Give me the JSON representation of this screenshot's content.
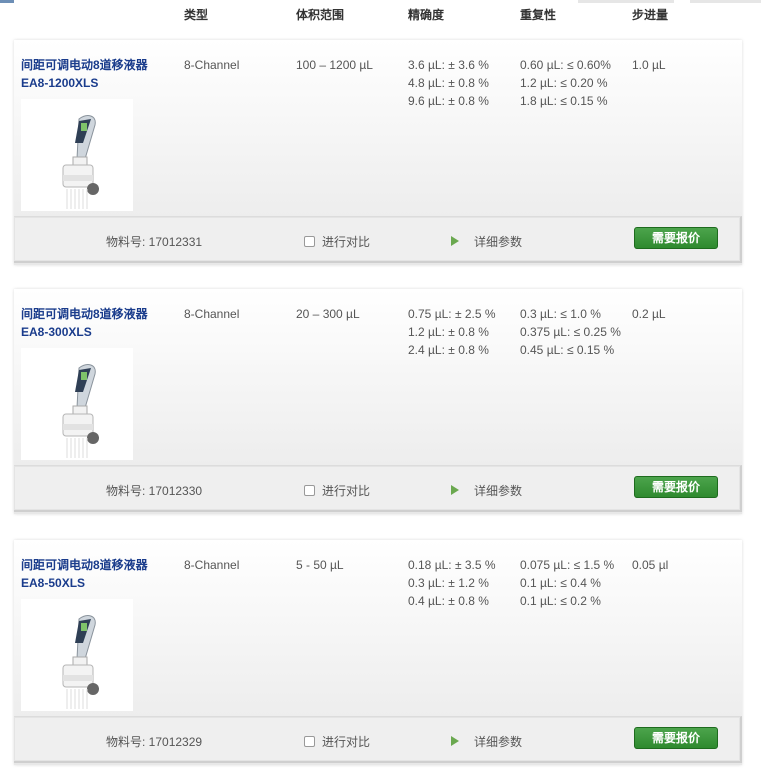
{
  "columns": {
    "type": "类型",
    "volume": "体积范围",
    "accuracy": "精确度",
    "repeatability": "重复性",
    "step": "步进量"
  },
  "products": [
    {
      "title": "间距可调电动8道移液器",
      "model": "EA8-1200XLS",
      "type": "8-Channel",
      "volume": "100 – 1200 µL",
      "accuracy": [
        "3.6 µL: ± 3.6 %",
        "4.8 µL: ± 0.8 %",
        "9.6 µL: ± 0.8 %"
      ],
      "repeatability": [
        "0.60 µL: ≤ 0.60%",
        "1.2 µL: ≤ 0.20 %",
        "1.8 µL: ≤ 0.15 %"
      ],
      "step": "1.0 µL",
      "material_label": "物料号: 17012331",
      "compare_label": "进行对比",
      "details_label": "详细参数",
      "quote_label": "需要报价"
    },
    {
      "title": "间距可调电动8道移液器",
      "model": "EA8-300XLS",
      "type": "8-Channel",
      "volume": "20 – 300 µL",
      "accuracy": [
        "0.75 µL: ± 2.5 %",
        "1.2 µL: ± 0.8 %",
        "2.4 µL: ± 0.8 %"
      ],
      "repeatability": [
        "0.3 µL: ≤ 1.0 %",
        "0.375 µL: ≤ 0.25 %",
        "0.45 µL: ≤ 0.15 %"
      ],
      "step": "0.2 µL",
      "material_label": "物料号: 17012330",
      "compare_label": "进行对比",
      "details_label": "详细参数",
      "quote_label": "需要报价"
    },
    {
      "title": "间距可调电动8道移液器",
      "model": "EA8-50XLS",
      "type": "8-Channel",
      "volume": "5 - 50 µL",
      "accuracy": [
        "0.18 µL: ± 3.5 %",
        "0.3 µL: ± 1.2 %",
        "0.4 µL: ± 0.8 %"
      ],
      "repeatability": [
        "0.075 µL: ≤ 1.5 %",
        "0.1 µL: ≤ 0.4 %",
        "0.1 µL: ≤ 0.2 %"
      ],
      "step": "0.05 µl",
      "material_label": "物料号: 17012329",
      "compare_label": "进行对比",
      "details_label": "详细参数",
      "quote_label": "需要报价"
    }
  ],
  "colors": {
    "title": "#1a3c8c",
    "quote_button": "#3a973a",
    "details_arrow": "#6aa84f"
  },
  "icons": {
    "compare": "checkbox-icon",
    "details": "play-arrow-icon",
    "product": "pipette-image"
  }
}
